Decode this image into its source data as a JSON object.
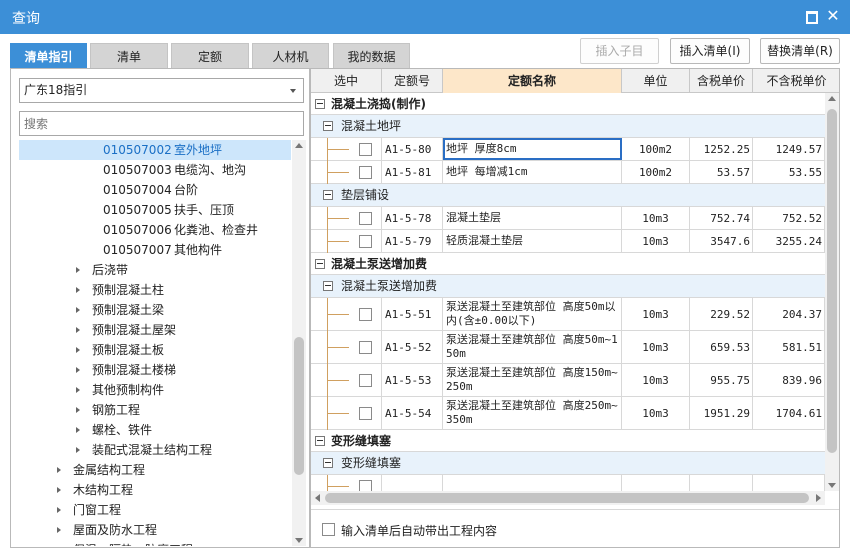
{
  "window": {
    "title": "查询",
    "maximize_icon": "maximize-icon",
    "close_glyph": "✕"
  },
  "tabs": [
    {
      "label": "清单指引",
      "active": true
    },
    {
      "label": "清单",
      "active": false
    },
    {
      "label": "定额",
      "active": false
    },
    {
      "label": "人材机",
      "active": false
    },
    {
      "label": "我的数据",
      "active": false
    }
  ],
  "buttons": {
    "insert_sub": "插入子目",
    "insert_list": "插入清单(I)",
    "replace_list": "替换清单(R)"
  },
  "left": {
    "guide_select": "广东18指引",
    "search_placeholder": "搜索",
    "tree": [
      {
        "code": "010507002",
        "name": "室外地坪",
        "level": 3,
        "selected": true
      },
      {
        "code": "010507003",
        "name": "电缆沟、地沟",
        "level": 3,
        "selected": false
      },
      {
        "code": "010507004",
        "name": "台阶",
        "level": 3,
        "selected": false
      },
      {
        "code": "010507005",
        "name": "扶手、压顶",
        "level": 3,
        "selected": false
      },
      {
        "code": "010507006",
        "name": "化粪池、检查井",
        "level": 3,
        "selected": false
      },
      {
        "code": "010507007",
        "name": "其他构件",
        "level": 3,
        "selected": false
      },
      {
        "code": "",
        "name": "后浇带",
        "level": 2,
        "selected": false
      },
      {
        "code": "",
        "name": "预制混凝土柱",
        "level": 2,
        "selected": false
      },
      {
        "code": "",
        "name": "预制混凝土梁",
        "level": 2,
        "selected": false
      },
      {
        "code": "",
        "name": "预制混凝土屋架",
        "level": 2,
        "selected": false
      },
      {
        "code": "",
        "name": "预制混凝土板",
        "level": 2,
        "selected": false
      },
      {
        "code": "",
        "name": "预制混凝土楼梯",
        "level": 2,
        "selected": false
      },
      {
        "code": "",
        "name": "其他预制构件",
        "level": 2,
        "selected": false
      },
      {
        "code": "",
        "name": "钢筋工程",
        "level": 2,
        "selected": false
      },
      {
        "code": "",
        "name": "螺栓、铁件",
        "level": 2,
        "selected": false
      },
      {
        "code": "",
        "name": "装配式混凝土结构工程",
        "level": 2,
        "selected": false
      },
      {
        "code": "",
        "name": "金属结构工程",
        "level": 1,
        "selected": false
      },
      {
        "code": "",
        "name": "木结构工程",
        "level": 1,
        "selected": false
      },
      {
        "code": "",
        "name": "门窗工程",
        "level": 1,
        "selected": false
      },
      {
        "code": "",
        "name": "屋面及防水工程",
        "level": 1,
        "selected": false
      },
      {
        "code": "",
        "name": "保温、隔热、防腐工程",
        "level": 1,
        "selected": false
      }
    ]
  },
  "grid": {
    "headers": [
      "选中",
      "定额号",
      "定额名称",
      "单位",
      "含税单价",
      "不含税单价"
    ],
    "rows": [
      {
        "kind": "group",
        "label": "混凝土浇捣(制作)"
      },
      {
        "kind": "sub",
        "label": "混凝土地坪"
      },
      {
        "kind": "data",
        "code": "A1-5-80",
        "name": "地坪 厚度8cm",
        "unit": "100m2",
        "tax_price": "1252.25",
        "notax_price": "1249.57",
        "focus": true
      },
      {
        "kind": "data",
        "code": "A1-5-81",
        "name": "地坪 每增减1cm",
        "unit": "100m2",
        "tax_price": "53.57",
        "notax_price": "53.55"
      },
      {
        "kind": "sub",
        "label": "垫层铺设"
      },
      {
        "kind": "data",
        "code": "A1-5-78",
        "name": "混凝土垫层",
        "unit": "10m3",
        "tax_price": "752.74",
        "notax_price": "752.52"
      },
      {
        "kind": "data",
        "code": "A1-5-79",
        "name": "轻质混凝土垫层",
        "unit": "10m3",
        "tax_price": "3547.6",
        "notax_price": "3255.24"
      },
      {
        "kind": "group",
        "label": "混凝土泵送增加费"
      },
      {
        "kind": "sub",
        "label": "混凝土泵送增加费"
      },
      {
        "kind": "data",
        "code": "A1-5-51",
        "name": "泵送混凝土至建筑部位 高度50m以内(含±0.00以下)",
        "unit": "10m3",
        "tax_price": "229.52",
        "notax_price": "204.37"
      },
      {
        "kind": "data",
        "code": "A1-5-52",
        "name": "泵送混凝土至建筑部位 高度50m~150m",
        "unit": "10m3",
        "tax_price": "659.53",
        "notax_price": "581.51"
      },
      {
        "kind": "data",
        "code": "A1-5-53",
        "name": "泵送混凝土至建筑部位 高度150m~250m",
        "unit": "10m3",
        "tax_price": "955.75",
        "notax_price": "839.96"
      },
      {
        "kind": "data",
        "code": "A1-5-54",
        "name": "泵送混凝土至建筑部位 高度250m~350m",
        "unit": "10m3",
        "tax_price": "1951.29",
        "notax_price": "1704.61"
      },
      {
        "kind": "group",
        "label": "变形缝填塞"
      },
      {
        "kind": "sub",
        "label": "变形缝填塞"
      },
      {
        "kind": "data",
        "code": "",
        "name": "",
        "unit": "",
        "tax_price": "",
        "notax_price": ""
      }
    ]
  },
  "footer": {
    "auto_bring_label": "输入清单后自动带出工程内容"
  },
  "colors": {
    "accent": "#3c8fd7",
    "header_highlight": "#fde7c9",
    "subgroup_bg": "#e8f2fb",
    "selected_bg": "#cde6fb"
  }
}
